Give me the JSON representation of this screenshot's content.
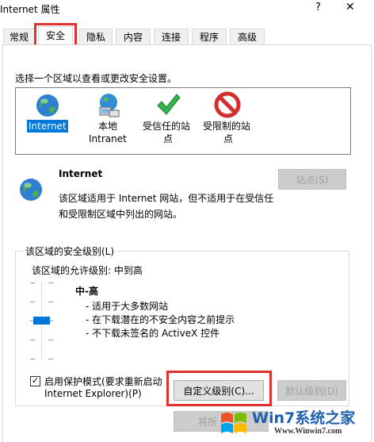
{
  "window": {
    "title": "Internet 属性",
    "help_glyph": "?",
    "close_glyph": "✕"
  },
  "tabs": [
    {
      "label": "常规"
    },
    {
      "label": "安全"
    },
    {
      "label": "隐私"
    },
    {
      "label": "内容"
    },
    {
      "label": "连接"
    },
    {
      "label": "程序"
    },
    {
      "label": "高级"
    }
  ],
  "security": {
    "instruction": "选择一个区域以查看或更改安全设置。",
    "zones": [
      {
        "label_lines": [
          "Internet"
        ],
        "icon": "globe-icon"
      },
      {
        "label_lines": [
          "本地",
          "Intranet"
        ],
        "icon": "intranet-icon"
      },
      {
        "label_lines": [
          "受信任的站",
          "点"
        ],
        "icon": "checkmark-icon"
      },
      {
        "label_lines": [
          "受限制的站",
          "点"
        ],
        "icon": "no-entry-icon"
      }
    ],
    "zone_title": "Internet",
    "zone_desc_line1": "该区域适用于 Internet 网站，但不适用于在受信任",
    "zone_desc_line2": "和受限制区域中列出的网站。",
    "sites_button": "站点(S)",
    "level_group": {
      "legend": "该区域的安全级别(L)",
      "allowed": "该区域的允许级别: 中到高",
      "level_name": "中-高",
      "bullets": [
        "- 适用于大多数网站",
        "- 在下载潜在的不安全内容之前提示",
        "- 不下载未签名的 ActiveX 控件"
      ],
      "protected_mode_line1": "启用保护模式(要求重新启动",
      "protected_mode_line2": "Internet Explorer)(P)",
      "protected_mode_checked": true,
      "custom_level_button": "自定义级别(C)...",
      "default_level_button": "默认级别(D)"
    },
    "reset_button_partial": "将所"
  },
  "watermark": {
    "brand": "Win7系统之家",
    "url": "Www.Winwin7.com"
  },
  "colors": {
    "highlight": "#0078d7",
    "annotation_red": "#e03030"
  }
}
